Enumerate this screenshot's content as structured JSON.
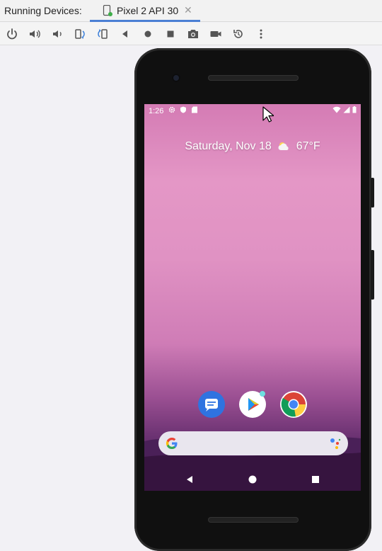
{
  "panel": {
    "label": "Running Devices:",
    "tab": {
      "title": "Pixel 2 API 30",
      "close": "✕"
    }
  },
  "toolbar": {
    "icons": [
      "power-icon",
      "volume-up-icon",
      "volume-down-icon",
      "rotate-left-icon",
      "rotate-right-icon",
      "back-icon",
      "home-icon",
      "overview-icon",
      "camera-icon",
      "record-icon",
      "reset-icon",
      "more-icon"
    ]
  },
  "device": {
    "status": {
      "time": "1:26"
    },
    "glance": {
      "date": "Saturday, Nov 18",
      "temp": "67°F"
    },
    "dock": [
      "messages-app",
      "play-store-app",
      "chrome-app"
    ]
  },
  "colors": {
    "tab_underline": "#4a7fd4",
    "phone_body": "#101010"
  }
}
